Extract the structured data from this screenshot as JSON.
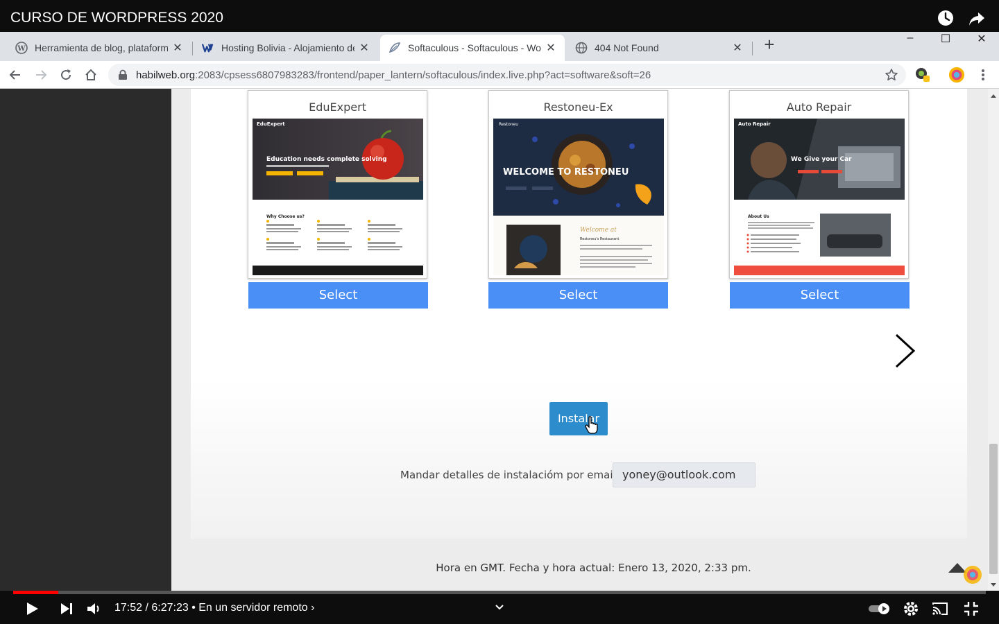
{
  "video": {
    "title": "CURSO DE WORDPRESS 2020",
    "time_display": "17:52 / 6:27:23 • En un servidor remoto ›",
    "progress_fraction": 0.0461
  },
  "browser": {
    "tabs": [
      {
        "label": "Herramienta de blog, plataforma",
        "icon": "wordpress-icon",
        "active": false
      },
      {
        "label": "Hosting Bolivia - Alojamiento de",
        "icon": "habilweb-icon",
        "active": false
      },
      {
        "label": "Softaculous - Softaculous - Word",
        "icon": "softaculous-icon",
        "active": true
      },
      {
        "label": "404 Not Found",
        "icon": "globe-icon",
        "active": false
      }
    ],
    "tab_close": "✕",
    "new_tab": "+",
    "window_controls": [
      "–",
      "☐",
      "✕"
    ],
    "url_host": "habilweb.org",
    "url_path": ":2083/cpsess6807983283/frontend/paper_lantern/softaculous/index.live.php?act=software&soft=26"
  },
  "page": {
    "themes": [
      {
        "name": "EduExpert",
        "select_label": "Select"
      },
      {
        "name": "Restoneu-Ex",
        "select_label": "Select"
      },
      {
        "name": "Auto Repair",
        "select_label": "Select"
      }
    ],
    "thumb_text": {
      "eduexpert_brand": "EduExpert",
      "eduexpert_headline": "Education needs complete solving",
      "eduexpert_section": "Why Choose us?",
      "restoneu_brand": "Restoneu",
      "restoneu_headline": "WELCOME TO RESTONEU",
      "restoneu_script": "Welcome at",
      "restoneu_sub": "Restoneu's Restaurant",
      "autorepair_brand": "Auto Repair",
      "autorepair_headline": "We Give your Car",
      "autorepair_section": "About Us"
    },
    "install_label": "Instalar",
    "email_label": "Mandar detalles de instalacióm por email a :",
    "email_value": "yoney@outlook.com",
    "footer": "Hora en GMT. Fecha y hora actual: Enero 13, 2020, 2:33 pm."
  },
  "colors": {
    "select_button": "#4a8ff5",
    "install_button": "#2d8ccc",
    "progress": "#ff0000"
  }
}
